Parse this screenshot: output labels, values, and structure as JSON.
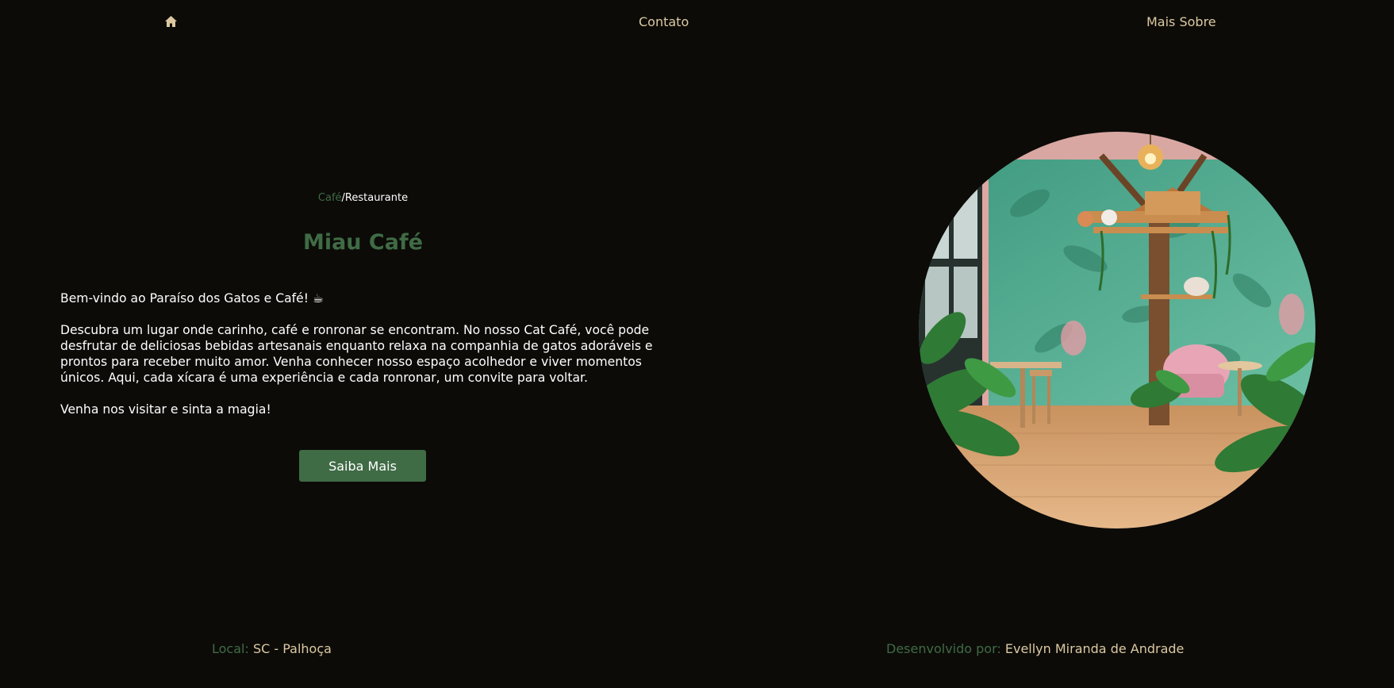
{
  "nav": {
    "home_icon": "home-icon",
    "links": [
      {
        "label": "Contato"
      },
      {
        "label": "Mais Sobre"
      }
    ]
  },
  "hero": {
    "eyebrow_accent": "Café",
    "eyebrow_rest": "/Restaurante",
    "title": "Miau Café",
    "paragraphs": [
      "Bem-vindo ao Paraíso dos Gatos e Café! ☕",
      "Descubra um lugar onde carinho, café e ronronar se encontram. No nosso Cat Café, você pode desfrutar de deliciosas bebidas artesanais enquanto relaxa na companhia de gatos adoráveis e prontos para receber muito amor. Venha conhecer nosso espaço acolhedor e viver momentos únicos. Aqui, cada xícara é uma experiência e cada ronronar, um convite para voltar.",
      "Venha nos visitar e sinta a magia!"
    ],
    "cta_label": "Saiba Mais"
  },
  "footer": {
    "local_label": "Local:",
    "local_value": "SC - Palhoça",
    "dev_label": "Desenvolvido por:",
    "dev_value": "Evellyn Miranda de Andrade"
  },
  "colors": {
    "background": "#0c0b08",
    "accent_green": "#3f6b45",
    "cream": "#dcc9a1",
    "text": "#ffffff"
  }
}
